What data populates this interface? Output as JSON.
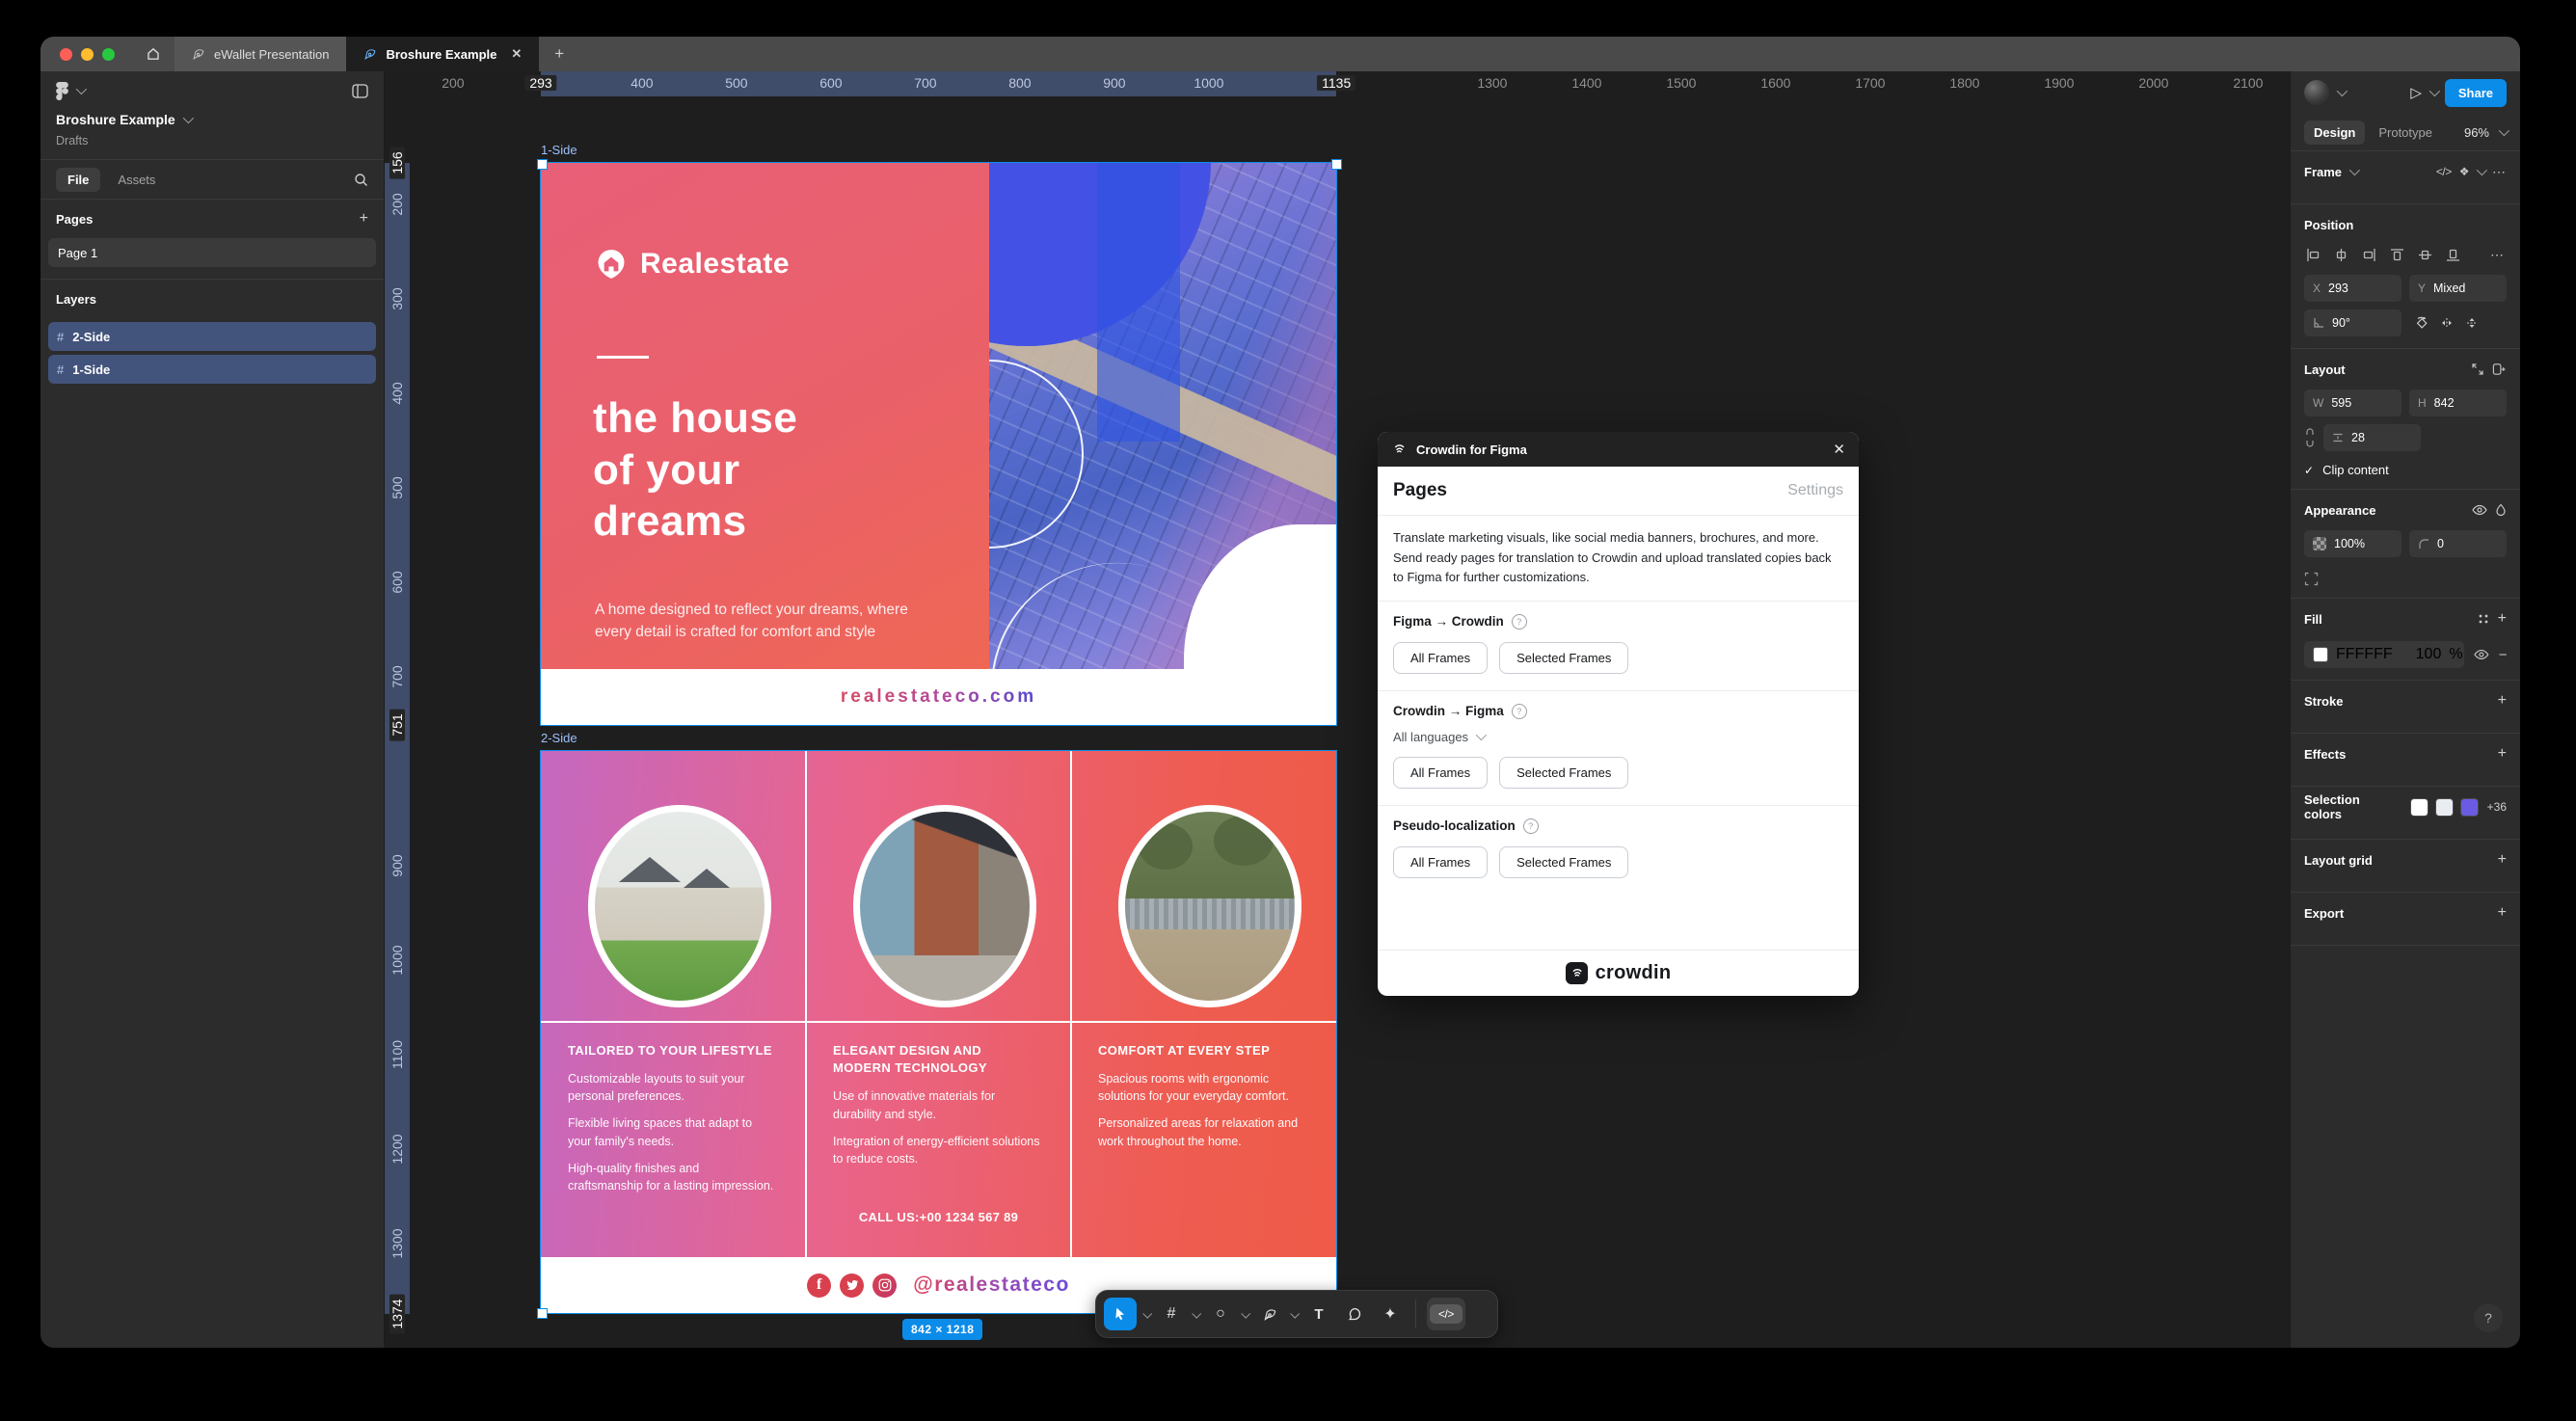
{
  "window": {
    "tabs": [
      {
        "label": "eWallet Presentation",
        "active": false
      },
      {
        "label": "Broshure Example",
        "active": true
      }
    ]
  },
  "sidebar": {
    "file_title": "Broshure Example",
    "file_location": "Drafts",
    "tabs": {
      "file": "File",
      "assets": "Assets"
    },
    "pages": {
      "header": "Pages",
      "items": [
        {
          "label": "Page 1",
          "selected": true
        }
      ]
    },
    "layers": {
      "header": "Layers",
      "items": [
        {
          "label": "2-Side",
          "selected": true
        },
        {
          "label": "1-Side",
          "selected": true
        }
      ]
    }
  },
  "inspector": {
    "share_label": "Share",
    "mode_tabs": {
      "design": "Design",
      "prototype": "Prototype"
    },
    "zoom_level": "96%",
    "selection_type": "Frame",
    "position": {
      "header": "Position",
      "x_label": "X",
      "x_value": "293",
      "y_label": "Y",
      "y_value": "Mixed",
      "rotation_value": "90°"
    },
    "layout": {
      "header": "Layout",
      "w_label": "W",
      "w_value": "595",
      "h_label": "H",
      "h_value": "842",
      "gap_value": "28",
      "clip_label": "Clip content"
    },
    "appearance": {
      "header": "Appearance",
      "opacity_value": "100%",
      "corner_radius_value": "0"
    },
    "fill": {
      "header": "Fill",
      "hex": "FFFFFF",
      "opacity": "100",
      "unit": "%"
    },
    "stroke": {
      "header": "Stroke"
    },
    "effects": {
      "header": "Effects"
    },
    "selection_colors": {
      "header": "Selection colors",
      "swatches": [
        "#FFFFFF",
        "#E9EDF1",
        "#6A5BE2"
      ],
      "overflow": "+36"
    },
    "layout_grid": {
      "header": "Layout grid"
    },
    "export": {
      "header": "Export"
    },
    "help": "?"
  },
  "rulers": {
    "h_selection": [
      293,
      1135
    ],
    "v_selection": [
      156,
      1374
    ],
    "horizontal": [
      {
        "v": 200
      },
      {
        "v": 293,
        "hl": true
      },
      {
        "v": 400
      },
      {
        "v": 500
      },
      {
        "v": 600
      },
      {
        "v": 700
      },
      {
        "v": 800
      },
      {
        "v": 900
      },
      {
        "v": 1000
      },
      {
        "v": 1135,
        "hl": true
      },
      {
        "v": 1300
      },
      {
        "v": 1400
      },
      {
        "v": 1500
      },
      {
        "v": 1600
      },
      {
        "v": 1700
      },
      {
        "v": 1800
      },
      {
        "v": 1900
      },
      {
        "v": 2000
      },
      {
        "v": 2100
      }
    ],
    "vertical": [
      {
        "v": 156,
        "hl": true
      },
      {
        "v": 200
      },
      {
        "v": 300
      },
      {
        "v": 400
      },
      {
        "v": 500
      },
      {
        "v": 600
      },
      {
        "v": 700
      },
      {
        "v": 751,
        "hl": true
      },
      {
        "v": 900
      },
      {
        "v": 1000
      },
      {
        "v": 1100
      },
      {
        "v": 1200
      },
      {
        "v": 1300
      },
      {
        "v": 1374,
        "hl": true
      }
    ]
  },
  "canvas": {
    "frames": [
      {
        "name": "1-Side"
      },
      {
        "name": "2-Side"
      }
    ],
    "selection_size_badge": "842 × 1218"
  },
  "brochure_front": {
    "brand": "Realestate",
    "heading_lines": [
      "the house",
      "of your",
      "dreams"
    ],
    "body": "A home designed to reflect your dreams, where every detail is crafted for comfort and style",
    "website": "realestateco.com"
  },
  "brochure_back": {
    "columns": [
      {
        "heading": "TAILORED TO YOUR LIFESTYLE",
        "paragraphs": [
          "Customizable layouts to suit your personal preferences.",
          "Flexible living spaces that adapt to your family's needs.",
          "High-quality finishes and craftsmanship for a lasting impression."
        ]
      },
      {
        "heading": "ELEGANT DESIGN AND MODERN TECHNOLOGY",
        "paragraphs": [
          "Use of innovative materials for durability and style.",
          "Integration of energy-efficient solutions to reduce costs."
        ],
        "phone": "CALL US:+00 1234 567 89"
      },
      {
        "heading": "COMFORT AT EVERY STEP",
        "paragraphs": [
          "Spacious rooms with ergonomic solutions for your everyday comfort.",
          "Personalized areas for relaxation and work throughout the home."
        ]
      }
    ],
    "social_handle": "@realestateco"
  },
  "plugin_dialog": {
    "title": "Crowdin for Figma",
    "nav": {
      "active": "Pages",
      "secondary": "Settings"
    },
    "description": "Translate marketing visuals, like social media banners, brochures, and more. Send ready pages for translation to Crowdin and upload translated copies back to Figma for further customizations.",
    "sections": [
      {
        "label": "Figma → Crowdin",
        "buttons": [
          "All Frames",
          "Selected Frames"
        ]
      },
      {
        "label": "Crowdin → Figma",
        "language_filter": "All languages",
        "buttons": [
          "All Frames",
          "Selected Frames"
        ]
      },
      {
        "label": "Pseudo-localization",
        "buttons": [
          "All Frames",
          "Selected Frames"
        ]
      }
    ],
    "footer_brand": "crowdin"
  },
  "toolbar": {
    "dev_mode_label": "</>"
  },
  "icons": {
    "close": "✕",
    "plus": "+",
    "more": "⋯",
    "minus": "−",
    "check": "✓",
    "code": "</>",
    "component": "❖",
    "text_tool": "T",
    "frame_tool": "#",
    "shape_tool": "○",
    "sparkle": "✦",
    "play": "▷",
    "question": "?"
  },
  "colors": {
    "accent_blue": "#0C8CE9",
    "panel_bg": "#2C2C2C",
    "canvas_bg": "#1E1E1E",
    "front_gradient": [
      "#E8607A",
      "#EE6452"
    ],
    "back_gradient": [
      "#C468C0",
      "#E9648B",
      "#EF5A49"
    ],
    "url_gradient": [
      "#D84A63",
      "#5348CF"
    ]
  }
}
